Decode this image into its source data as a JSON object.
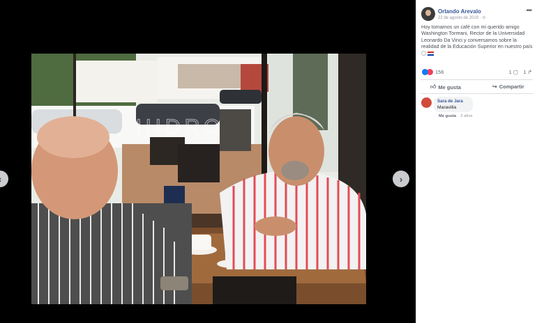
{
  "post": {
    "author": "Orlando Arevalo",
    "date": "22 de agosto de 2019 · ",
    "text": "Hoy tomamos un café con mi querido amigo Washington Torreani, Rector de la Universidad Leonardo Da Vinci y conversamos sobre la realidad de la Educación Superior en nuestro país",
    "more_icon": "more-dots-icon"
  },
  "reactions": {
    "count": "156",
    "comments": "1",
    "shares": "1"
  },
  "actions": {
    "like_label": "Me gusta",
    "share_label": "Compartir"
  },
  "comment": {
    "name": "Sara de Jara",
    "text": "Maravilla",
    "like_label": "Me gusta",
    "time": "3 años"
  },
  "colors": {
    "link": "#385898",
    "like": "#1877f2",
    "love": "#f33e58",
    "background": "#000000"
  }
}
